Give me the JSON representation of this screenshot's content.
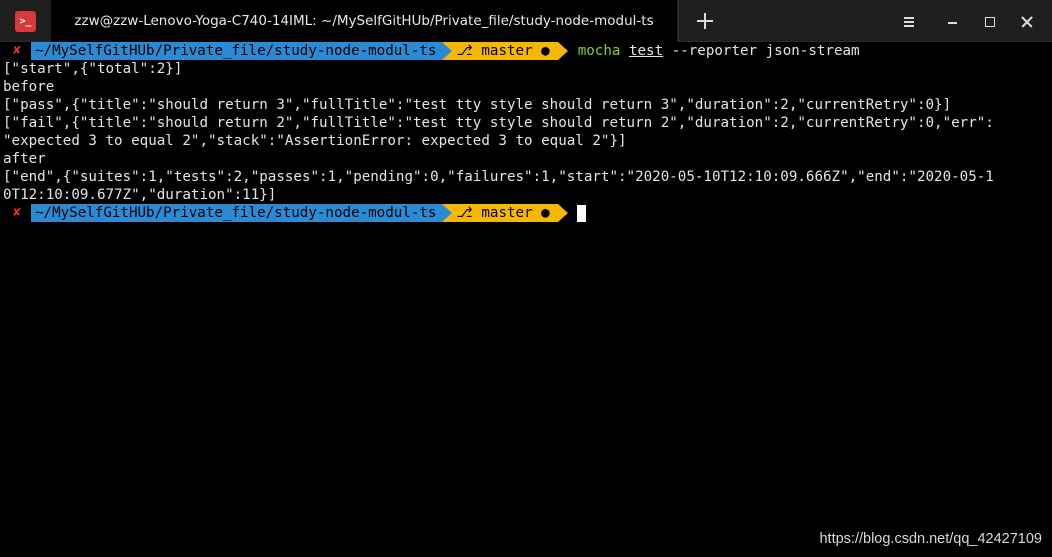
{
  "window": {
    "tab_title": "zzw@zzw-Lenovo-Yoga-C740-14IML: ~/MySelfGitHUb/Private_file/study-node-modul-ts",
    "app_icon_glyph": ">_"
  },
  "prompt": {
    "status_glyph": "✘",
    "path": "~/MySelfGitHUb/Private_file/study-node-modul-ts",
    "branch": "master",
    "branch_icon": "branch-icon",
    "dirty_marker": "●"
  },
  "command": {
    "program": "mocha",
    "argument": "test",
    "rest": "--reporter json-stream"
  },
  "output_lines": [
    "[\"start\",{\"total\":2}]",
    "before",
    "[\"pass\",{\"title\":\"should return 3\",\"fullTitle\":\"test tty style should return 3\",\"duration\":2,\"currentRetry\":0}]",
    "[\"fail\",{\"title\":\"should return 2\",\"fullTitle\":\"test tty style should return 2\",\"duration\":2,\"currentRetry\":0,\"err\":",
    "\"expected 3 to equal 2\",\"stack\":\"AssertionError: expected 3 to equal 2\"}]",
    "after",
    "[\"end\",{\"suites\":1,\"tests\":2,\"passes\":1,\"pending\":0,\"failures\":1,\"start\":\"2020-05-10T12:10:09.666Z\",\"end\":\"2020-05-1",
    "0T12:10:09.677Z\",\"duration\":11}]"
  ],
  "watermark": "https://blog.csdn.net/qq_42427109",
  "colors": {
    "path_bg": "#2a8ad4",
    "git_bg": "#f5b700",
    "error": "#e8322b",
    "command": "#7ad03a",
    "app_icon": "#d7393d"
  }
}
